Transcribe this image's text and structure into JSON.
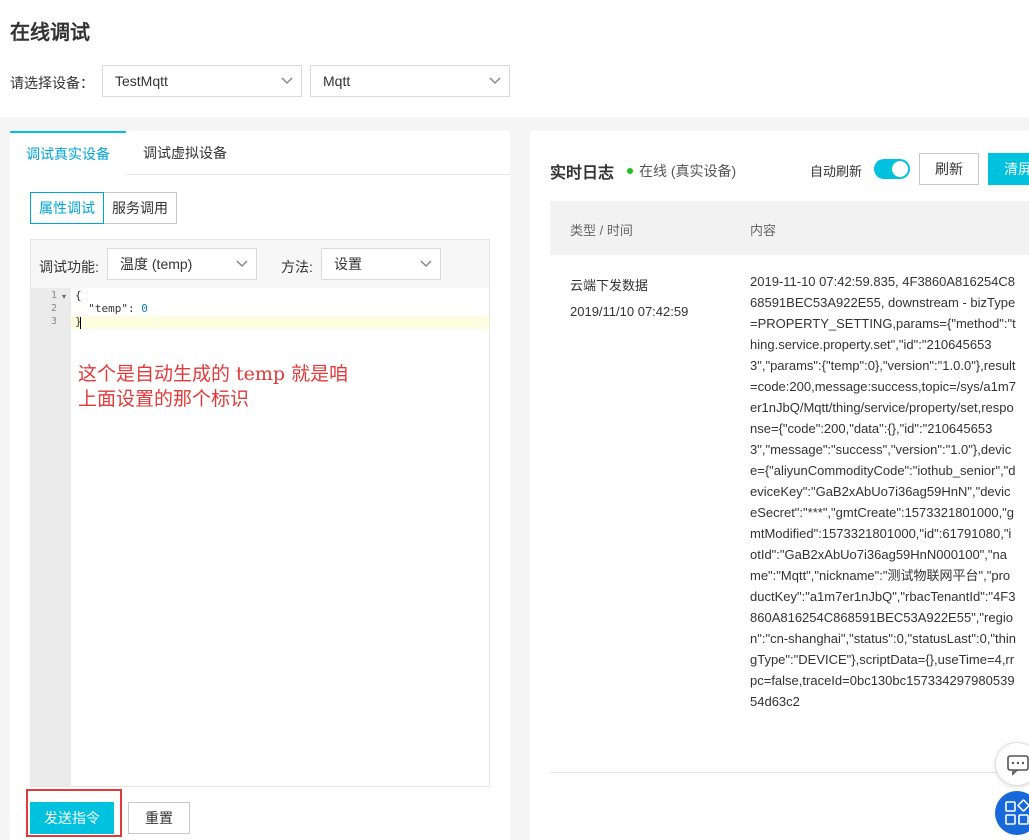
{
  "page": {
    "title": "在线调试",
    "device_label": "请选择设备：",
    "product_select": "TestMqtt",
    "device_select": "Mqtt"
  },
  "left": {
    "tabs": [
      {
        "label": "调试真实设备",
        "active": true
      },
      {
        "label": "调试虚拟设备",
        "active": false
      }
    ],
    "segments": [
      {
        "label": "属性调试",
        "active": true
      },
      {
        "label": "服务调用",
        "active": false
      }
    ],
    "function_label": "调试功能:",
    "function_value": "温度 (temp)",
    "method_label": "方法:",
    "method_value": "设置",
    "editor": {
      "line_numbers": [
        "1",
        "2",
        "3"
      ],
      "line1": "{",
      "line2_key": "  \"temp\": ",
      "line2_value": "0",
      "line3": "}"
    },
    "annotation_line1": "这个是自动生成的 temp 就是咱",
    "annotation_line2": "上面设置的那个标识",
    "send_button": "发送指令",
    "reset_button": "重置"
  },
  "right": {
    "title": "实时日志",
    "status": "在线 (真实设备)",
    "status_color": "#1dc11d",
    "auto_refresh_label": "自动刷新",
    "auto_refresh_on": true,
    "refresh_button": "刷新",
    "clear_button": "清屏",
    "columns": [
      "类型 / 时间",
      "内容"
    ],
    "log_row": {
      "type": "云端下发数据",
      "time": "2019/11/10 07:42:59",
      "content": "2019-11-10 07:42:59.835, 4F3860A816254C868591BEC53A922E55, downstream - bizType=PROPERTY_SETTING,params={\"method\":\"thing.service.property.set\",\"id\":\"2106456533\",\"params\":{\"temp\":0},\"version\":\"1.0.0\"},result=code:200,message:success,topic=/sys/a1m7er1nJbQ/Mqtt/thing/service/property/set,response={\"code\":200,\"data\":{},\"id\":\"2106456533\",\"message\":\"success\",\"version\":\"1.0\"},device={\"aliyunCommodityCode\":\"iothub_senior\",\"deviceKey\":\"GaB2xAbUo7i36ag59HnN\",\"deviceSecret\":\"***\",\"gmtCreate\":1573321801000,\"gmtModified\":1573321801000,\"id\":61791080,\"iotId\":\"GaB2xAbUo7i36ag59HnN000100\",\"name\":\"Mqtt\",\"nickname\":\"测试物联网平台\",\"productKey\":\"a1m7er1nJbQ\",\"rbacTenantId\":\"4F3860A816254C868591BEC53A922E55\",\"region\":\"cn-shanghai\",\"status\":0,\"statusLast\":0,\"thingType\":\"DEVICE\"},scriptData={},useTime=4,rrpc=false,traceId=0bc130bc15733429798053954d63c2"
    }
  },
  "floating": {
    "chat_icon": "chat-bubble-icon",
    "apps_icon": "apps-grid-icon"
  },
  "colors": {
    "accent": "#00c1de",
    "accent_text": "#00a4d8",
    "annotation": "#e23a3a",
    "float_blue": "#1768d8"
  }
}
